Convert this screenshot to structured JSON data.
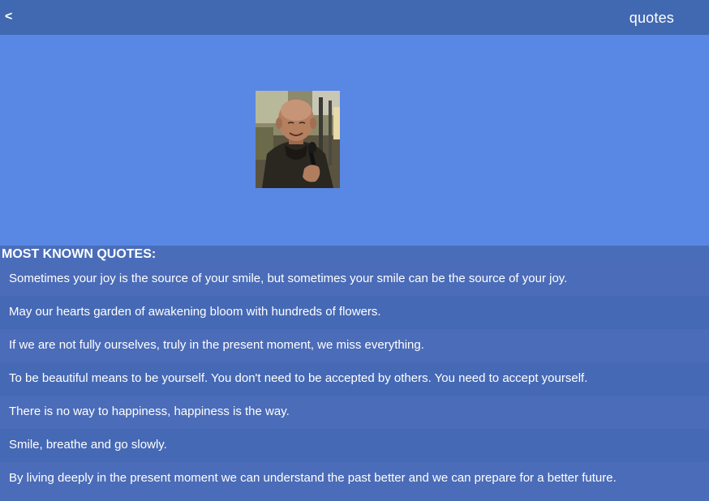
{
  "header": {
    "back_label": "<",
    "title": "quotes"
  },
  "hero": {
    "portrait_icon": "person-portrait-photo"
  },
  "quotes_section": {
    "heading": "MOST KNOWN QUOTES:",
    "items": [
      {
        "text": "Sometimes your joy is the source of your smile, but sometimes your smile can be the source of your joy."
      },
      {
        "text": "May our hearts garden of awakening bloom with hundreds of flowers."
      },
      {
        "text": "If we are not fully ourselves, truly in the present moment, we miss everything."
      },
      {
        "text": "To be beautiful means to be yourself. You don't need to be accepted by others. You need to accept yourself."
      },
      {
        "text": "There is no way to happiness, happiness is the way."
      },
      {
        "text": "Smile, breathe and go slowly."
      },
      {
        "text": "By living deeply in the present moment we can understand the past better and we can prepare for a better future."
      }
    ]
  },
  "colors": {
    "header_bg": "#4169b2",
    "hero_bg": "#5887e4",
    "list_bg": "#4a6dba",
    "text": "#ffffff"
  }
}
